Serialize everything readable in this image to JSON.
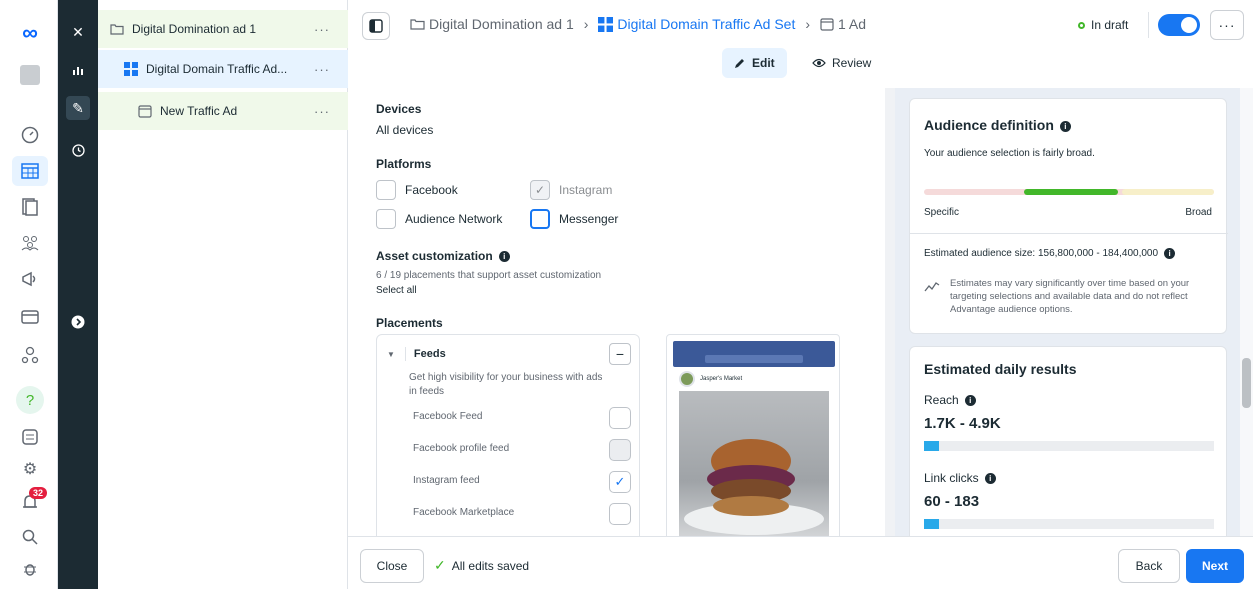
{
  "tree": {
    "items": [
      {
        "label": "Digital Domination ad 1",
        "more": "···"
      },
      {
        "label": "Digital Domain Traffic Ad...",
        "more": "···"
      },
      {
        "label": "New Traffic Ad",
        "more": "···"
      }
    ]
  },
  "rail": {
    "badge": "32"
  },
  "header": {
    "crumbs": [
      "Digital Domination ad 1",
      "Digital Domain Traffic Ad Set",
      "1 Ad"
    ],
    "status": "In draft",
    "more": "···",
    "tabs": {
      "edit": "Edit",
      "review": "Review"
    }
  },
  "form": {
    "devices_label": "Devices",
    "devices_value": "All devices",
    "platforms_label": "Platforms",
    "platforms": [
      {
        "label": "Facebook",
        "state": "unchecked"
      },
      {
        "label": "Instagram",
        "state": "checked-disabled"
      },
      {
        "label": "Audience Network",
        "state": "unchecked"
      },
      {
        "label": "Messenger",
        "state": "focused"
      }
    ],
    "asset_label": "Asset customization",
    "asset_count": "6 / 19 placements that support asset customization",
    "select_all": "Select all",
    "placements_label": "Placements",
    "feeds_label": "Feeds",
    "feeds_desc": "Get high visibility for your business with ads in feeds",
    "placements": [
      {
        "label": "Facebook Feed",
        "state": "unchecked"
      },
      {
        "label": "Facebook profile feed",
        "state": "disabled"
      },
      {
        "label": "Instagram feed",
        "state": "checked"
      },
      {
        "label": "Facebook Marketplace",
        "state": "unchecked"
      }
    ],
    "preview_page": "Jasper's Market"
  },
  "insights": {
    "audience_title": "Audience definition",
    "audience_desc": "Your audience selection is fairly broad.",
    "specific": "Specific",
    "broad": "Broad",
    "est_size": "Estimated audience size: 156,800,000 - 184,400,000",
    "est_note": "Estimates may vary significantly over time based on your targeting selections and available data and do not reflect Advantage audience options.",
    "daily_title": "Estimated daily results",
    "reach_label": "Reach",
    "reach_value": "1.7K - 4.9K",
    "reach_fill": 0.05,
    "clicks_label": "Link clicks",
    "clicks_value": "60 - 183",
    "clicks_fill": 0.05
  },
  "footer": {
    "close": "Close",
    "saved": "All edits saved",
    "back": "Back",
    "next": "Next"
  }
}
